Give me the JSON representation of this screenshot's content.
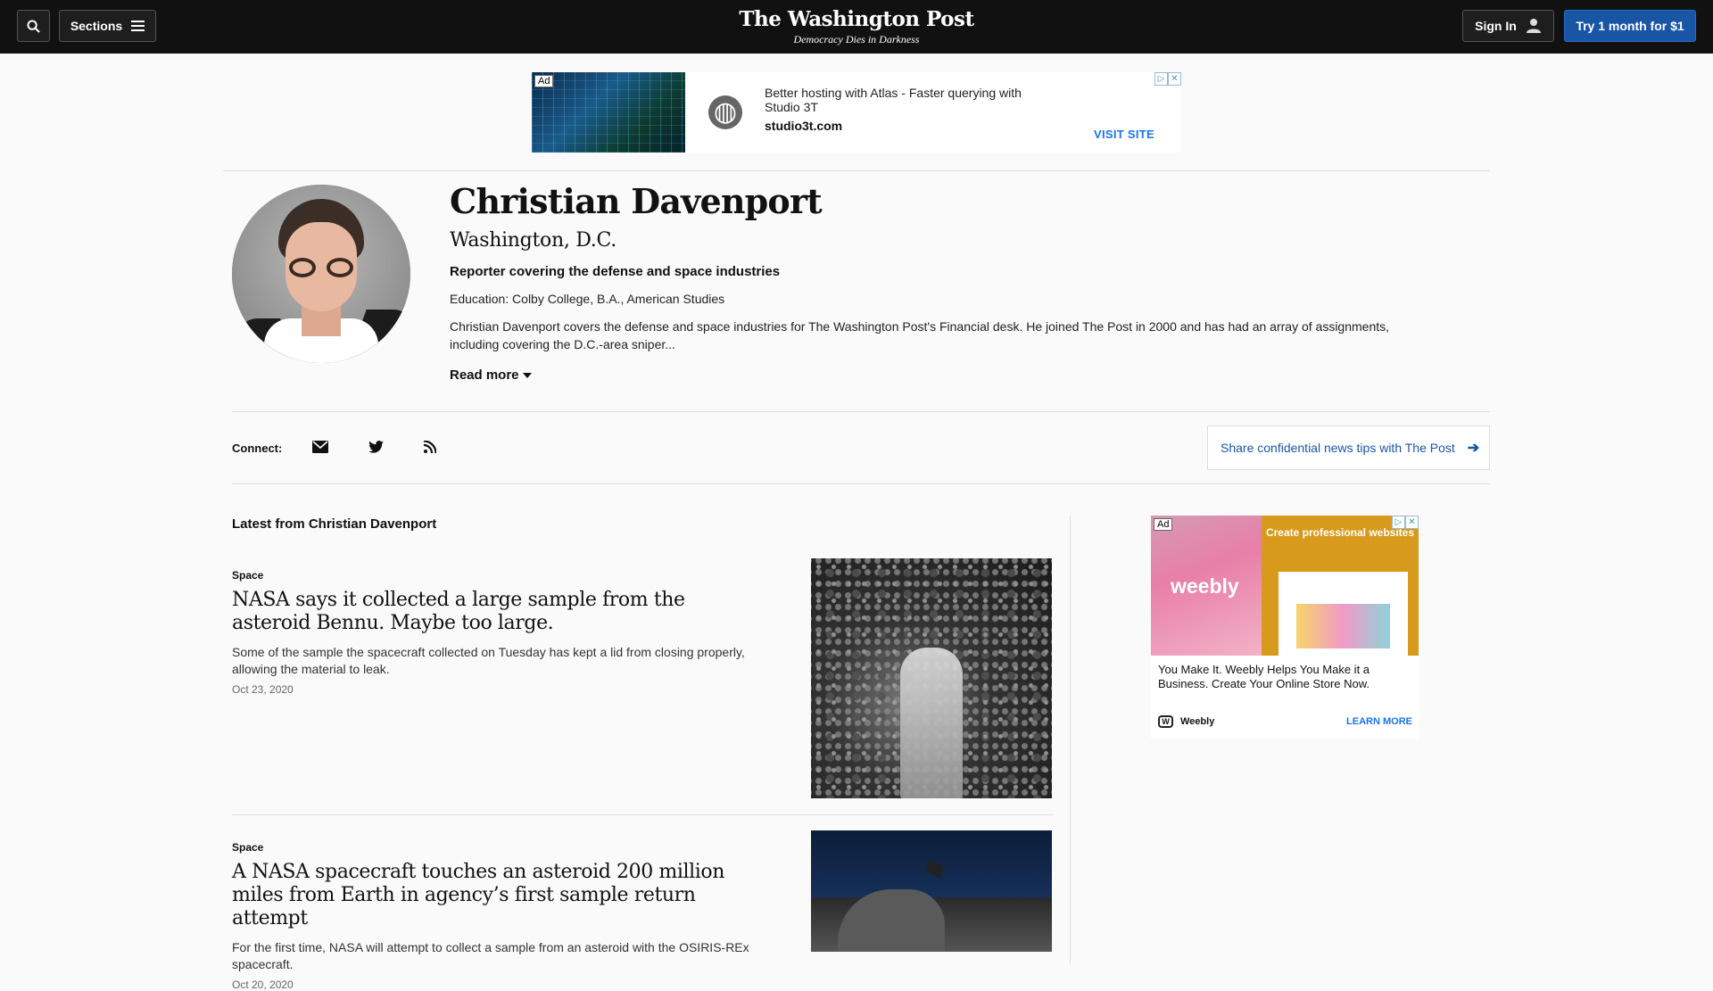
{
  "header": {
    "sections_label": "Sections",
    "logo_name": "The Washington Post",
    "logo_tagline": "Democracy Dies in Darkness",
    "signin_label": "Sign In",
    "try_label": "Try 1 month for $1"
  },
  "ad_top": {
    "tag": "Ad",
    "headline": "Better hosting with Atlas - Faster querying with Studio 3T",
    "domain": "studio3t.com",
    "cta": "VISIT SITE",
    "icon": "globe-icon"
  },
  "profile": {
    "name": "Christian Davenport",
    "location": "Washington, D.C.",
    "role": "Reporter covering the defense and space industries",
    "education": "Education: Colby College, B.A., American Studies",
    "bio": "Christian Davenport covers the defense and space industries for The Washington Post's Financial desk. He joined The Post in 2000 and has had an array of assignments, including covering the D.C.-area sniper...",
    "read_more": "Read more"
  },
  "connect": {
    "label": "Connect:",
    "icons": [
      "mail-icon",
      "twitter-icon",
      "rss-icon"
    ],
    "tips_label": "Share confidential news tips with The Post"
  },
  "latest": {
    "heading": "Latest from Christian Davenport",
    "stories": [
      {
        "kicker": "Space",
        "headline": "NASA says it collected a large sample from the asteroid Bennu. Maybe too large.",
        "blurb": "Some of the sample the spacecraft collected on Tuesday has kept a lid from closing properly, allowing the material to leak.",
        "date": "Oct 23, 2020"
      },
      {
        "kicker": "Space",
        "headline": "A NASA spacecraft touches an asteroid 200 million miles from Earth in agency’s first sample return attempt",
        "blurb": "For the first time, NASA will attempt to collect a sample from an asteroid with the OSIRIS-REx spacecraft.",
        "date": "Oct 20, 2020"
      }
    ]
  },
  "ad_side": {
    "tag": "Ad",
    "logo": "weebly",
    "cta_text": "Create professional websites",
    "body": "You Make It. Weebly Helps You Make it a Business. Create Your Online Store Now.",
    "brand": "Weebly",
    "learn_more": "LEARN MORE"
  },
  "colors": {
    "header_bg": "#111111",
    "accent_blue": "#1955a5",
    "link_blue": "#1a73e8"
  }
}
